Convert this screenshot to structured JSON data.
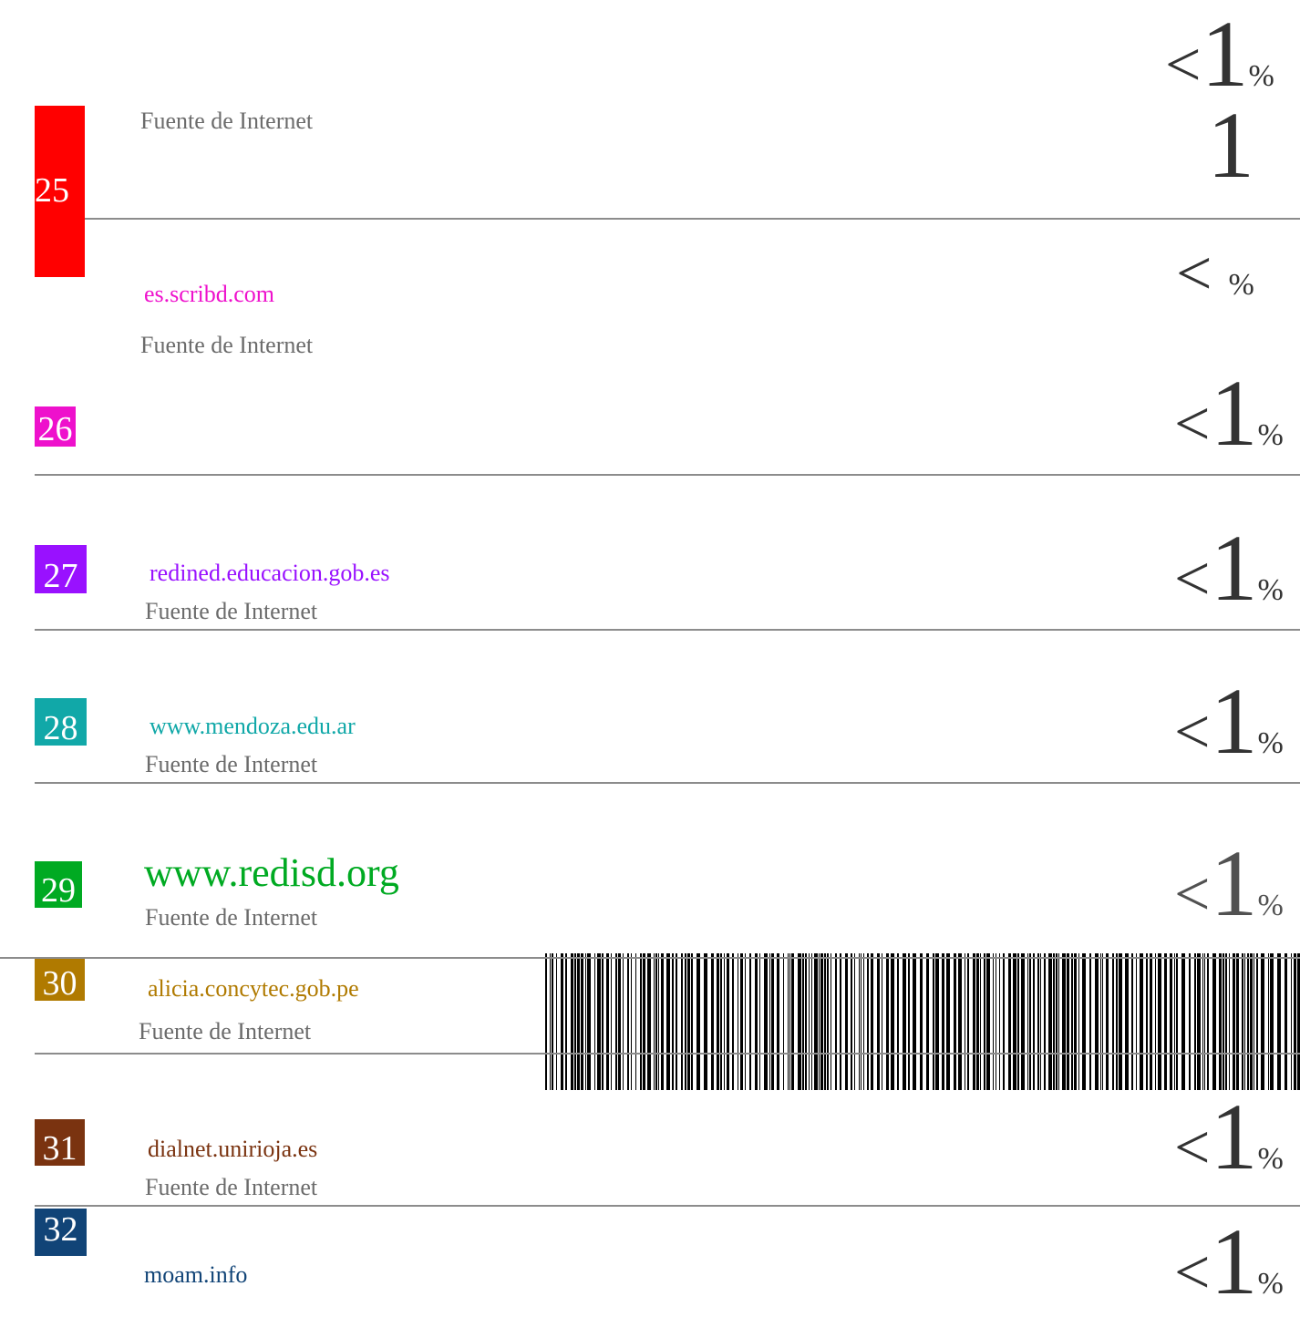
{
  "header_percent": {
    "lt": "<",
    "one": "1",
    "sym": "%"
  },
  "entries": [
    {
      "number": "25",
      "color": "#ff0000",
      "source": "",
      "type": "Fuente de Internet",
      "percent": {
        "lt": "",
        "one": "1",
        "sym": ""
      }
    },
    {
      "number": "26",
      "color": "#ee11cc",
      "source": "es.scribd.com",
      "type": "Fuente de Internet",
      "percent": {
        "lt": "<",
        "one": "",
        "sym": "%"
      },
      "percent2": {
        "lt": "<",
        "one": "1",
        "sym": "%"
      }
    },
    {
      "number": "27",
      "color": "#9911ff",
      "source": "redined.educacion.gob.es",
      "type": "Fuente de Internet",
      "percent": {
        "lt": "<",
        "one": "1",
        "sym": "%"
      }
    },
    {
      "number": "28",
      "color": "#11a8a8",
      "source": "www.mendoza.edu.ar",
      "type": "Fuente de Internet",
      "percent": {
        "lt": "<",
        "one": "1",
        "sym": "%"
      }
    },
    {
      "number": "29",
      "color": "#00aa22",
      "source": "www.redisd.org",
      "type": "Fuente de Internet",
      "percent": {
        "lt": "<",
        "one": "1",
        "sym": "%"
      }
    },
    {
      "number": "30",
      "color": "#b07a00",
      "source": "alicia.concytec.gob.pe",
      "type": "Fuente de Internet",
      "percent": {
        "lt": "",
        "one": "",
        "sym": ""
      }
    },
    {
      "number": "31",
      "color": "#7a3310",
      "source": "dialnet.unirioja.es",
      "type": "Fuente de Internet",
      "percent": {
        "lt": "<",
        "one": "1",
        "sym": "%"
      }
    },
    {
      "number": "32",
      "color": "#114477",
      "source": "moam.info",
      "type": "",
      "percent": {
        "lt": "<",
        "one": "1",
        "sym": "%"
      }
    }
  ]
}
